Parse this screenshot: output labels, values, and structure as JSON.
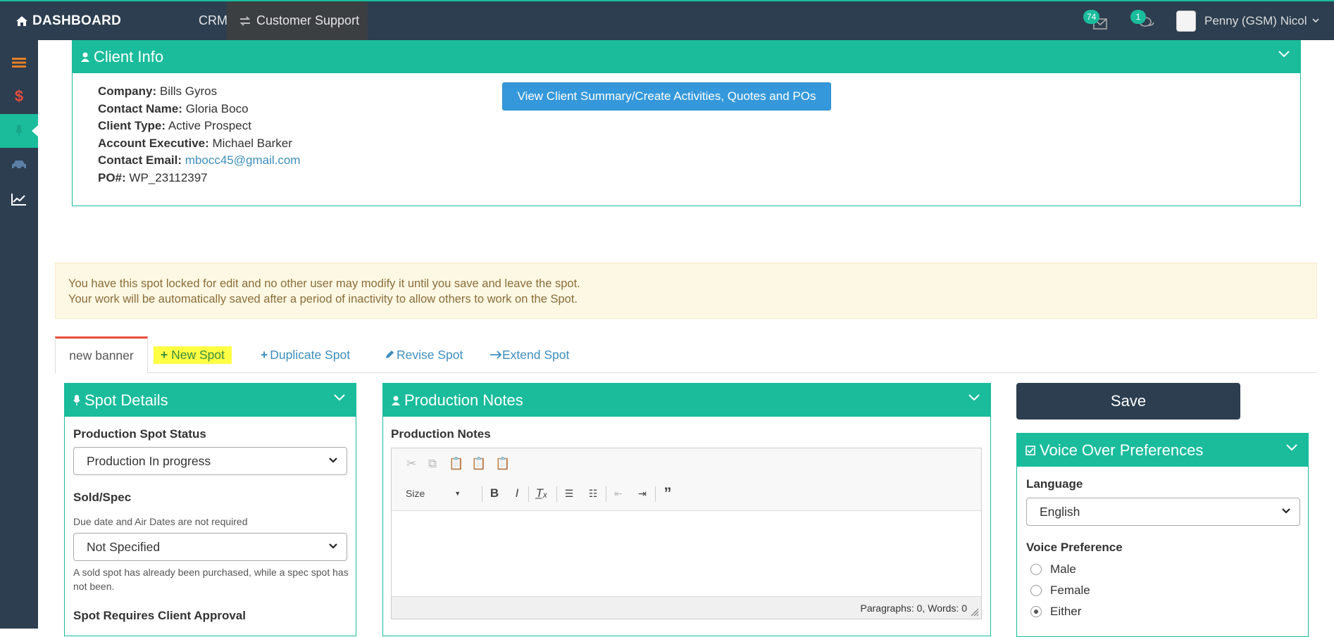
{
  "topbar": {
    "brand": "DASHBOARD",
    "nav_crm": "CRM",
    "nav_customer_support": "Customer Support",
    "mail_count": "74",
    "chat_count": "1",
    "user_name": "Penny (GSM) Nicol"
  },
  "sidebar": {
    "items": [
      "list-icon",
      "dollar-icon",
      "microphone-icon",
      "car-icon",
      "chart-icon"
    ],
    "active_index": 2
  },
  "client_info": {
    "title": "Client Info",
    "company_label": "Company:",
    "company": "Bills Gyros",
    "contact_label": "Contact Name:",
    "contact": "Gloria Boco",
    "type_label": "Client Type:",
    "type": "Active Prospect",
    "ae_label": "Account Executive:",
    "ae": "Michael Barker",
    "email_label": "Contact Email:",
    "email": "mbocc45@gmail.com",
    "po_label": "PO#:",
    "po": "WP_23112397",
    "summary_button": "View Client Summary/Create Activities, Quotes and POs"
  },
  "alert": {
    "line1": "You have this spot locked for edit and no other user may modify it until you save and leave the spot.",
    "line2": "Your work will be automatically saved after a period of inactivity to allow others to work on the Spot."
  },
  "tabs": {
    "active": "new banner",
    "new_spot": "New Spot",
    "duplicate_spot": "Duplicate Spot",
    "revise_spot": "Revise Spot",
    "extend_spot": "Extend Spot"
  },
  "spot_details": {
    "title": "Spot Details",
    "status_label": "Production Spot Status",
    "status_value": "Production In progress",
    "sold_label": "Sold/Spec",
    "sold_help": "Due date and Air Dates are not required",
    "sold_value": "Not Specified",
    "sold_note": "A sold spot has already been purchased, while a spec spot has not been.",
    "approval_label": "Spot Requires Client Approval"
  },
  "production_notes": {
    "title": "Production Notes",
    "field_label": "Production Notes",
    "size_label": "Size",
    "status_text": "Paragraphs: 0, Words: 0"
  },
  "right": {
    "save": "Save",
    "vo_title": "Voice Over Preferences",
    "language_label": "Language",
    "language_value": "English",
    "voice_label": "Voice Preference",
    "voice_options": [
      "Male",
      "Female",
      "Either"
    ],
    "voice_selected": "Either"
  },
  "colors": {
    "accent": "#1abc9c",
    "navbar": "#2c3e50",
    "button_blue": "#3498db",
    "highlight": "#ffff44",
    "alert_bg": "#fcf8e3"
  }
}
